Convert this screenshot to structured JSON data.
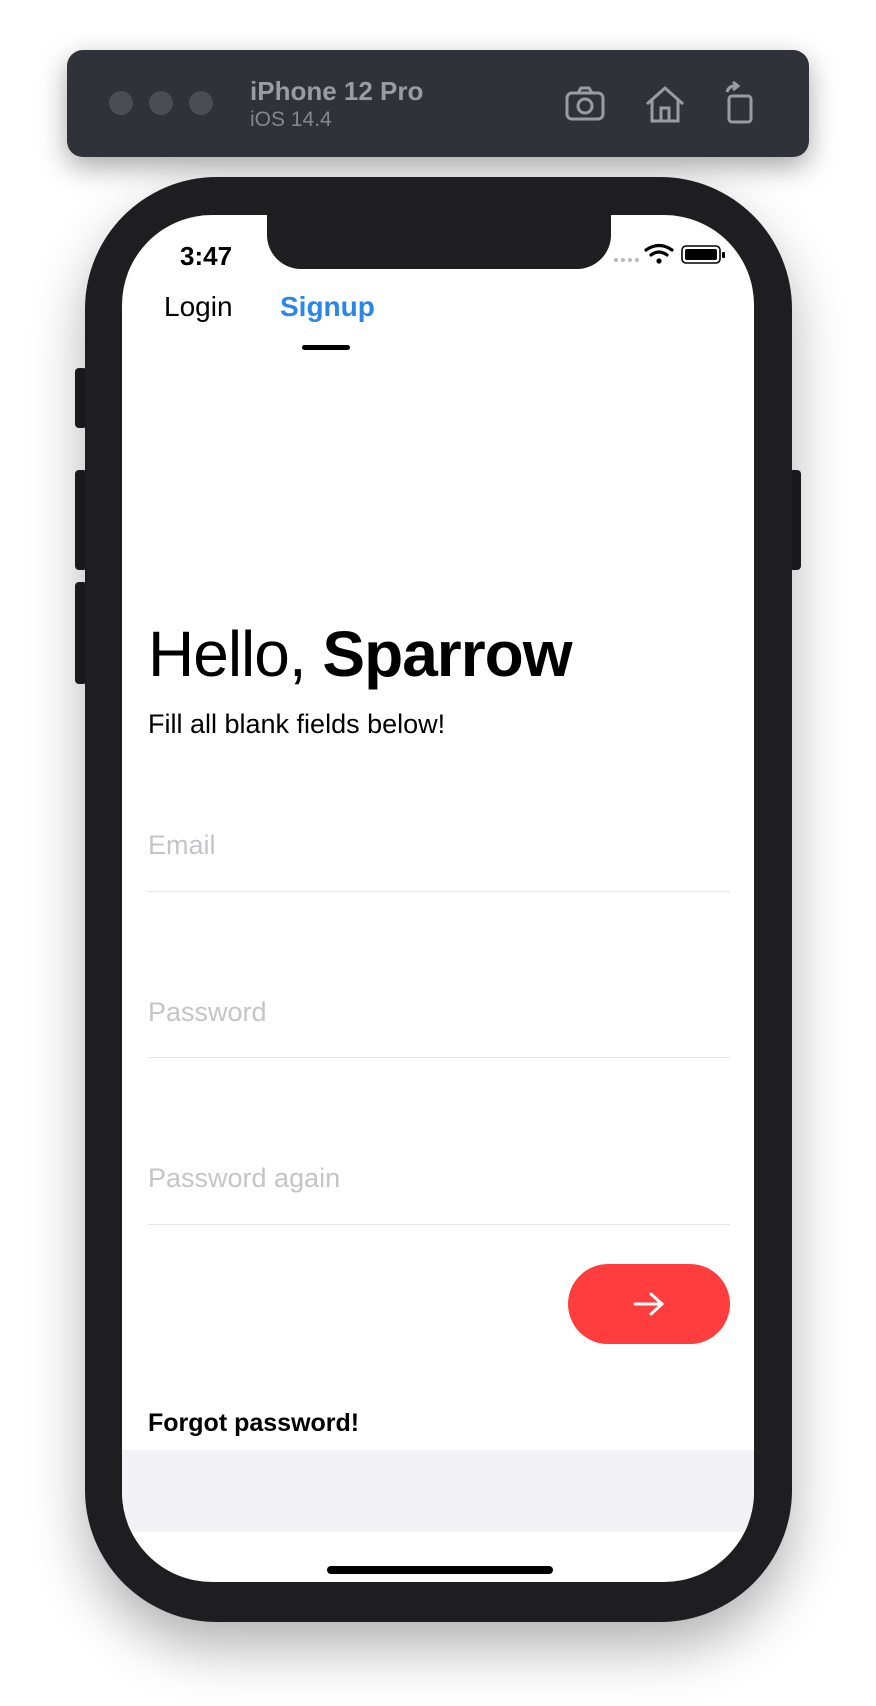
{
  "simulator": {
    "device_name": "iPhone 12 Pro",
    "os_version": "iOS 14.4",
    "icons": [
      "screenshot-camera-icon",
      "home-icon",
      "rotate-icon"
    ]
  },
  "status_bar": {
    "time": "3:47",
    "icons": [
      "signal-icon",
      "wifi-icon",
      "battery-icon"
    ]
  },
  "tabs": {
    "login_label": "Login",
    "signup_label": "Signup",
    "active": "Signup"
  },
  "greeting": {
    "hello": "Hello, ",
    "name": "Sparrow",
    "subtitle": "Fill all blank fields below!"
  },
  "form": {
    "email_placeholder": "Email",
    "password_placeholder": "Password",
    "password_again_placeholder": "Password again",
    "submit_icon": "arrow-right-icon"
  },
  "links": {
    "forgot_password": "Forgot password!"
  },
  "colors": {
    "accent_blue": "#2b86e8",
    "submit_red": "#ff3d3e",
    "placeholder_gray": "#c5c5c9",
    "band_gray": "#f2f2f7"
  }
}
